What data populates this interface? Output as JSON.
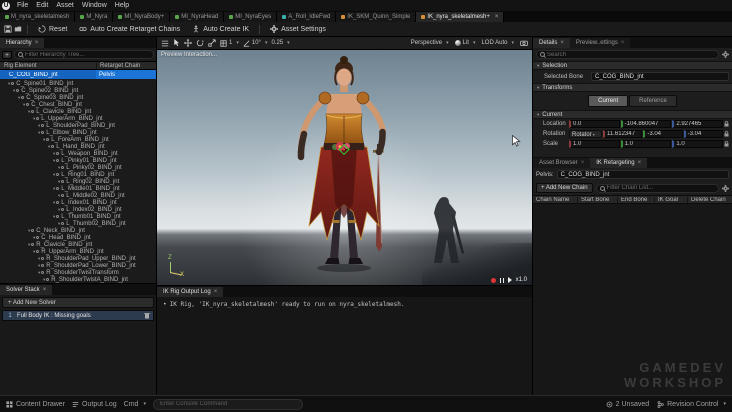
{
  "window": {
    "menu_items": [
      "File",
      "Edit",
      "Asset",
      "Window",
      "Help"
    ]
  },
  "asset_tabs": [
    {
      "label": "M_nyra_skeletalmesh",
      "color": "#57a64a"
    },
    {
      "label": "M_Nyra",
      "color": "#57a64a"
    },
    {
      "label": "MI_NyraBody+",
      "color": "#57a64a"
    },
    {
      "label": "MI_NyraHead",
      "color": "#57a64a"
    },
    {
      "label": "MI_NyraEyes",
      "color": "#57a64a"
    },
    {
      "label": "A_Roll_IdleFwd",
      "color": "#39b0ac"
    },
    {
      "label": "IK_SKM_Quinn_Simple",
      "color": "#d78f36"
    },
    {
      "label": "IK_nyra_skeletalmesh+",
      "color": "#d78f36",
      "active": true
    }
  ],
  "main_toolbar": {
    "reset": "Reset",
    "auto_retarget": "Auto Create Retarget Chains",
    "auto_ik": "Auto Create IK",
    "asset_settings": "Asset Settings"
  },
  "viewport_toolbar": {
    "move_snap": "1",
    "rotate_snap": "10°",
    "scale_snap": "0.25",
    "perspective": "Perspective",
    "lit": "Lit",
    "lod": "LOD Auto"
  },
  "viewport": {
    "preview_label": "Preview Interaction...",
    "speed": "x1.0",
    "axis_z": "Z",
    "axis_x": "X"
  },
  "hierarchy": {
    "tab": "Hierarchy",
    "filter_placeholder": "Filter Hierarchy Tree...",
    "col_rig_element": "Rig Element",
    "col_retarget_chain": "Retarget Chain",
    "root_bone": "C_COG_BIND_jnt",
    "root_chain": "Pelvis",
    "bones": [
      {
        "label": "C_Spine01_BIND_jnt",
        "indent": 1
      },
      {
        "label": "C_Spine02_BIND_jnt",
        "indent": 2
      },
      {
        "label": "C_Spine03_BIND_jnt",
        "indent": 3
      },
      {
        "label": "C_Chest_BIND_jnt",
        "indent": 4
      },
      {
        "label": "L_Clavicle_BIND_jnt",
        "indent": 5
      },
      {
        "label": "L_UpperArm_BIND_jnt",
        "indent": 6
      },
      {
        "label": "L_ShoulderPad_BIND_jnt",
        "indent": 7
      },
      {
        "label": "L_Elbow_BIND_jnt",
        "indent": 7
      },
      {
        "label": "L_ForeArm_BIND_jnt",
        "indent": 8
      },
      {
        "label": "L_Hand_BIND_jnt",
        "indent": 9
      },
      {
        "label": "L_Weapon_BIND_jnt",
        "indent": 10
      },
      {
        "label": "L_Pinky01_BIND_jnt",
        "indent": 10
      },
      {
        "label": "L_Pinky02_BIND_jnt",
        "indent": 11
      },
      {
        "label": "L_Ring01_BIND_jnt",
        "indent": 10
      },
      {
        "label": "L_Ring02_BIND_jnt",
        "indent": 11
      },
      {
        "label": "L_Middle01_BIND_jnt",
        "indent": 10
      },
      {
        "label": "L_Middle02_BIND_jnt",
        "indent": 11
      },
      {
        "label": "L_Index01_BIND_jnt",
        "indent": 10
      },
      {
        "label": "L_Index02_BIND_jnt",
        "indent": 11
      },
      {
        "label": "L_Thumb01_BIND_jnt",
        "indent": 10
      },
      {
        "label": "L_Thumb02_BIND_jnt",
        "indent": 11
      },
      {
        "label": "C_Neck_BIND_jnt",
        "indent": 5
      },
      {
        "label": "C_Head_BIND_jnt",
        "indent": 6
      },
      {
        "label": "R_Clavicle_BIND_jnt",
        "indent": 5
      },
      {
        "label": "R_UpperArm_BIND_jnt",
        "indent": 6
      },
      {
        "label": "R_ShoulderPad_Upper_BIND_jnt",
        "indent": 7
      },
      {
        "label": "R_ShoulderPad_Lower_BIND_jnt",
        "indent": 7
      },
      {
        "label": "R_ShoulderTwistTransform",
        "indent": 7
      },
      {
        "label": "R_ShoulderTwistA_BIND_jnt",
        "indent": 8
      },
      {
        "label": "R_ForeArm_BIND_jnt",
        "indent": 8
      }
    ]
  },
  "solver_stack": {
    "tab": "Solver Stack",
    "add_button": "+ Add New Solver",
    "items": [
      {
        "index": "1",
        "label": "Full Body IK : Missing goals"
      }
    ]
  },
  "output_log": {
    "tab": "IK Rig Output Log",
    "message": "IK Rig, 'IK_nyra_skeletalmesh' ready to run on nyra_skeletalmesh."
  },
  "details": {
    "tab": "Details",
    "preview_tab": "Preview..ettings",
    "search_placeholder": "Search",
    "selection_header": "Selection",
    "selected_bone_label": "Selected Bone",
    "selected_bone_value": "C_COG_BIND_jnt",
    "transforms_header": "Transforms",
    "current_button": "Current",
    "reference_button": "Reference",
    "current_header": "Current",
    "location_label": "Location",
    "location_values": [
      "0.0",
      "-104.860047",
      "2.927465"
    ],
    "rotation_label": "Rotation",
    "rotation_dropdown": "Rotator",
    "rotation_values": [
      "11.612347",
      "-3.04",
      "-3.04"
    ],
    "scale_label": "Scale",
    "scale_values": [
      "1.0",
      "1.0",
      "1.0"
    ]
  },
  "retargeting": {
    "tab_asset_browser": "Asset Browser",
    "tab_ik_retargeting": "IK Retargeting",
    "pelvis_label": "Pelvis:",
    "pelvis_value": "C_COG_BIND_jnt",
    "add_chain_button": "+ Add New Chain",
    "filter_placeholder": "Filter Chain List...",
    "columns": [
      "Chain Name",
      "Start Bone",
      "End Bone",
      "IK Goal",
      "Delete Chain"
    ]
  },
  "status_bar": {
    "content_drawer": "Content Drawer",
    "output_log": "Output Log",
    "cmd": "Cmd",
    "console_placeholder": "Enter Console Command",
    "unsaved": "2 Unsaved",
    "revision_control": "Revision Control"
  },
  "watermark": {
    "line1": "GAMEDEV",
    "line2": "WORKSHOP"
  },
  "colors": {
    "selection_blue": "#1565c0",
    "accent_blue": "#0070e0"
  }
}
